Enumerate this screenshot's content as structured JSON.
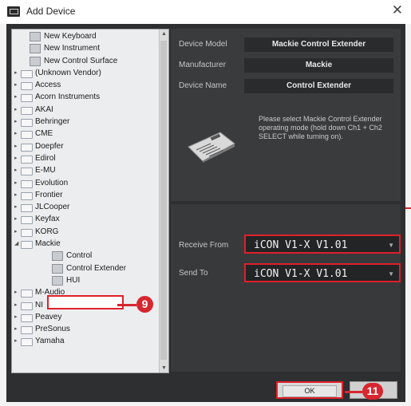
{
  "window": {
    "title": "Add Device",
    "close_glyph": "✕"
  },
  "tree": {
    "items": [
      {
        "label": "New Keyboard",
        "type": "device",
        "indent": 0,
        "arrow": ""
      },
      {
        "label": "New Instrument",
        "type": "device",
        "indent": 0,
        "arrow": ""
      },
      {
        "label": "New Control Surface",
        "type": "device",
        "indent": 0,
        "arrow": ""
      },
      {
        "label": "(Unknown Vendor)",
        "type": "folder",
        "indent": 0,
        "arrow": "▸"
      },
      {
        "label": "Access",
        "type": "folder",
        "indent": 0,
        "arrow": "▸"
      },
      {
        "label": "Acorn Instruments",
        "type": "folder",
        "indent": 0,
        "arrow": "▸"
      },
      {
        "label": "AKAI",
        "type": "folder",
        "indent": 0,
        "arrow": "▸"
      },
      {
        "label": "Behringer",
        "type": "folder",
        "indent": 0,
        "arrow": "▸"
      },
      {
        "label": "CME",
        "type": "folder",
        "indent": 0,
        "arrow": "▸"
      },
      {
        "label": "Doepfer",
        "type": "folder",
        "indent": 0,
        "arrow": "▸"
      },
      {
        "label": "Edirol",
        "type": "folder",
        "indent": 0,
        "arrow": "▸"
      },
      {
        "label": "E-MU",
        "type": "folder",
        "indent": 0,
        "arrow": "▸"
      },
      {
        "label": "Evolution",
        "type": "folder",
        "indent": 0,
        "arrow": "▸"
      },
      {
        "label": "Frontier",
        "type": "folder",
        "indent": 0,
        "arrow": "▸"
      },
      {
        "label": "JLCooper",
        "type": "folder",
        "indent": 0,
        "arrow": "▸"
      },
      {
        "label": "Keyfax",
        "type": "folder",
        "indent": 0,
        "arrow": "▸"
      },
      {
        "label": "KORG",
        "type": "folder",
        "indent": 0,
        "arrow": "▸"
      },
      {
        "label": "Mackie",
        "type": "folder",
        "indent": 0,
        "arrow": "◢"
      },
      {
        "label": "Control",
        "type": "device",
        "indent": 1,
        "arrow": ""
      },
      {
        "label": "Control Extender",
        "type": "device",
        "indent": 1,
        "arrow": "",
        "selected": true
      },
      {
        "label": "HUI",
        "type": "device",
        "indent": 1,
        "arrow": ""
      },
      {
        "label": "M-Audio",
        "type": "folder",
        "indent": 0,
        "arrow": "▸"
      },
      {
        "label": "NI",
        "type": "folder",
        "indent": 0,
        "arrow": "▸"
      },
      {
        "label": "Peavey",
        "type": "folder",
        "indent": 0,
        "arrow": "▸"
      },
      {
        "label": "PreSonus",
        "type": "folder",
        "indent": 0,
        "arrow": "▸"
      },
      {
        "label": "Yamaha",
        "type": "folder",
        "indent": 0,
        "arrow": "▸"
      }
    ]
  },
  "device": {
    "model_label": "Device Model",
    "model_value": "Mackie Control Extender",
    "manufacturer_label": "Manufacturer",
    "manufacturer_value": "Mackie",
    "name_label": "Device Name",
    "name_value": "Control Extender",
    "description": "Please select Mackie Control Extender operating mode (hold down Ch1 + Ch2 SELECT while turning on)."
  },
  "ports": {
    "receive_label": "Receive From",
    "receive_value": "iCON V1-X V1.01",
    "send_label": "Send To",
    "send_value": "iCON V1-X V1.01"
  },
  "buttons": {
    "ok": "OK"
  },
  "badges": {
    "step_9": "9",
    "step_11": "11"
  },
  "colors": {
    "highlight": "#e0202a",
    "badge": "#d6262f"
  }
}
